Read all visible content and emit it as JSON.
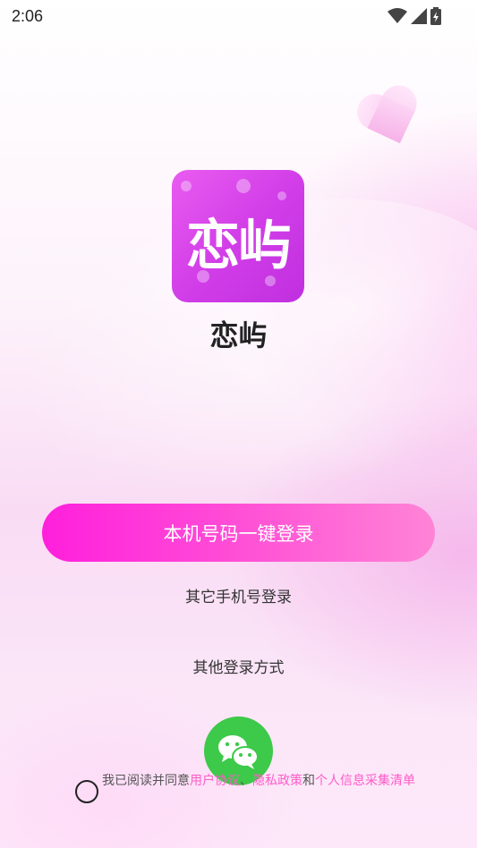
{
  "status_bar": {
    "time": "2:06",
    "icons": [
      "wifi-icon",
      "signal-icon",
      "battery-icon"
    ]
  },
  "app": {
    "logo_text": "恋屿",
    "name": "恋屿"
  },
  "login": {
    "primary_button": "本机号码一键登录",
    "other_phone_login": "其它手机号登录",
    "other_methods_label": "其他登录方式",
    "wechat_icon": "wechat-icon"
  },
  "agreement": {
    "prefix": "我已阅读并同意",
    "user_agreement": "用户协议",
    "separator": "、",
    "privacy_policy": "隐私政策",
    "and": "和",
    "info_list": "个人信息采集清单"
  },
  "colors": {
    "accent": "#ff1fdc",
    "link": "#ff5bc8",
    "wechat": "#3dc94a"
  }
}
